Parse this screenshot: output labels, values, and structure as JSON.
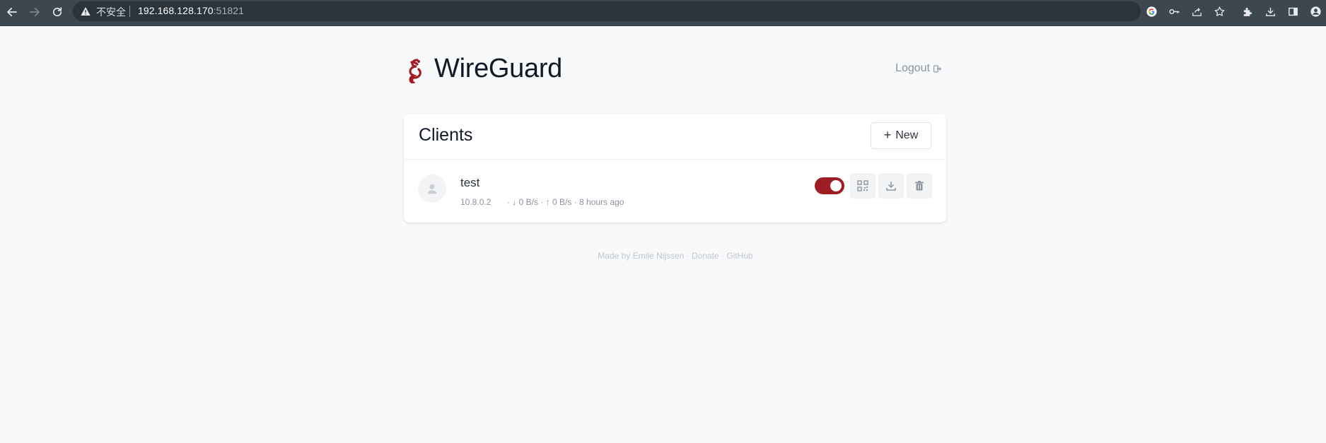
{
  "browser": {
    "insecure_label": "不安全",
    "url_host": "192.168.128.170",
    "url_port": ":51821"
  },
  "header": {
    "brand": "WireGuard",
    "logout_label": "Logout"
  },
  "clients_panel": {
    "title": "Clients",
    "new_button_label": "New",
    "clients": [
      {
        "name": "test",
        "ip": "10.8.0.2",
        "stats": "· ↓ 0 B/s · ↑ 0 B/s · 8 hours ago",
        "enabled": true
      }
    ]
  },
  "footer": {
    "text": "Made by Emile Nijssen · Donate · GitHub"
  },
  "colors": {
    "accent": "#9f1d24",
    "page_background": "#f8f9fa",
    "browser_chrome": "#3c4750"
  },
  "icons": {
    "logo": "wireguard-logo",
    "logout": "logout-icon",
    "avatar": "user-icon",
    "qr": "qr-code-icon",
    "download": "download-icon",
    "delete": "trash-icon"
  }
}
